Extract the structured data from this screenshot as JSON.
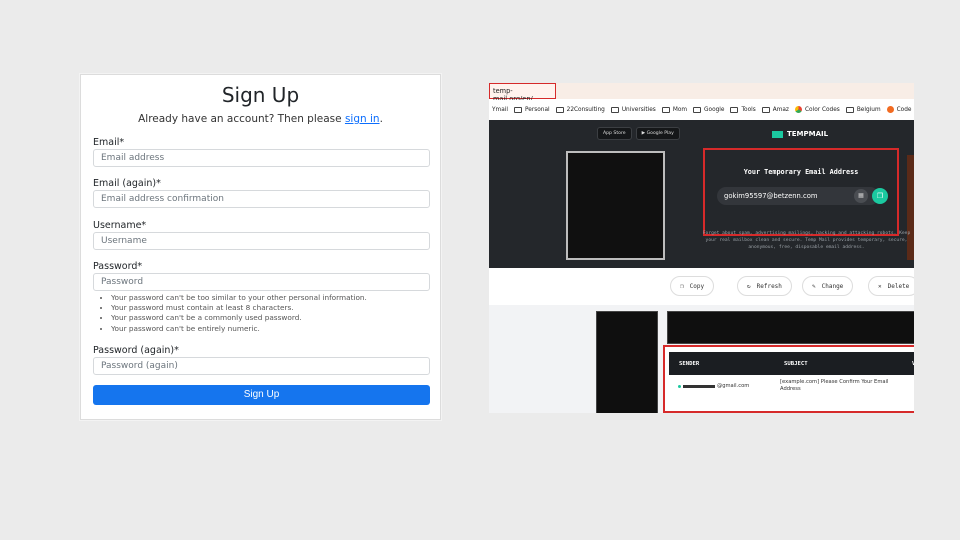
{
  "signup": {
    "title": "Sign Up",
    "already_prefix": "Already have an account? Then please ",
    "signin_link": "sign in",
    "already_suffix": ".",
    "fields": [
      {
        "label": "Email*",
        "placeholder": "Email address"
      },
      {
        "label": "Email (again)*",
        "placeholder": "Email address confirmation"
      },
      {
        "label": "Username*",
        "placeholder": "Username"
      },
      {
        "label": "Password*",
        "placeholder": "Password"
      },
      {
        "label": "Password (again)*",
        "placeholder": "Password (again)"
      }
    ],
    "password_rules": [
      "Your password can't be too similar to your other personal information.",
      "Your password must contain at least 8 characters.",
      "Your password can't be a commonly used password.",
      "Your password can't be entirely numeric."
    ],
    "submit_label": "Sign Up"
  },
  "browser": {
    "url": "temp-mail.org/en/",
    "bookmarks": [
      "Ymail",
      "Personal",
      "22Consulting",
      "Universities",
      "Mom",
      "Google",
      "Tools",
      "Amaz",
      "Color Codes",
      "Belgium",
      "Code"
    ],
    "store_buttons": [
      "App Store",
      "Google Play"
    ],
    "brand": "TEMPMAIL",
    "temp_title": "Your Temporary Email Address",
    "temp_email": "gokim95597@betzenn.com",
    "description": "Forget about spam, advertising mailings, hacking and attacking robots. Keep your real mailbox clean and secure. Temp Mail provides temporary, secure, anonymous, free, disposable email address.",
    "actions": [
      "Copy",
      "Refresh",
      "Change",
      "Delete"
    ],
    "inbox": {
      "col_sender": "SENDER",
      "col_subject": "SUBJECT",
      "col_view": "VI",
      "sender_suffix": "@gmail.com",
      "subject": "[example.com] Please Confirm Your Email Address"
    },
    "colors": {
      "accent": "#1bc9a0",
      "highlight": "#d62a2a",
      "primary": "#1575ee"
    }
  }
}
